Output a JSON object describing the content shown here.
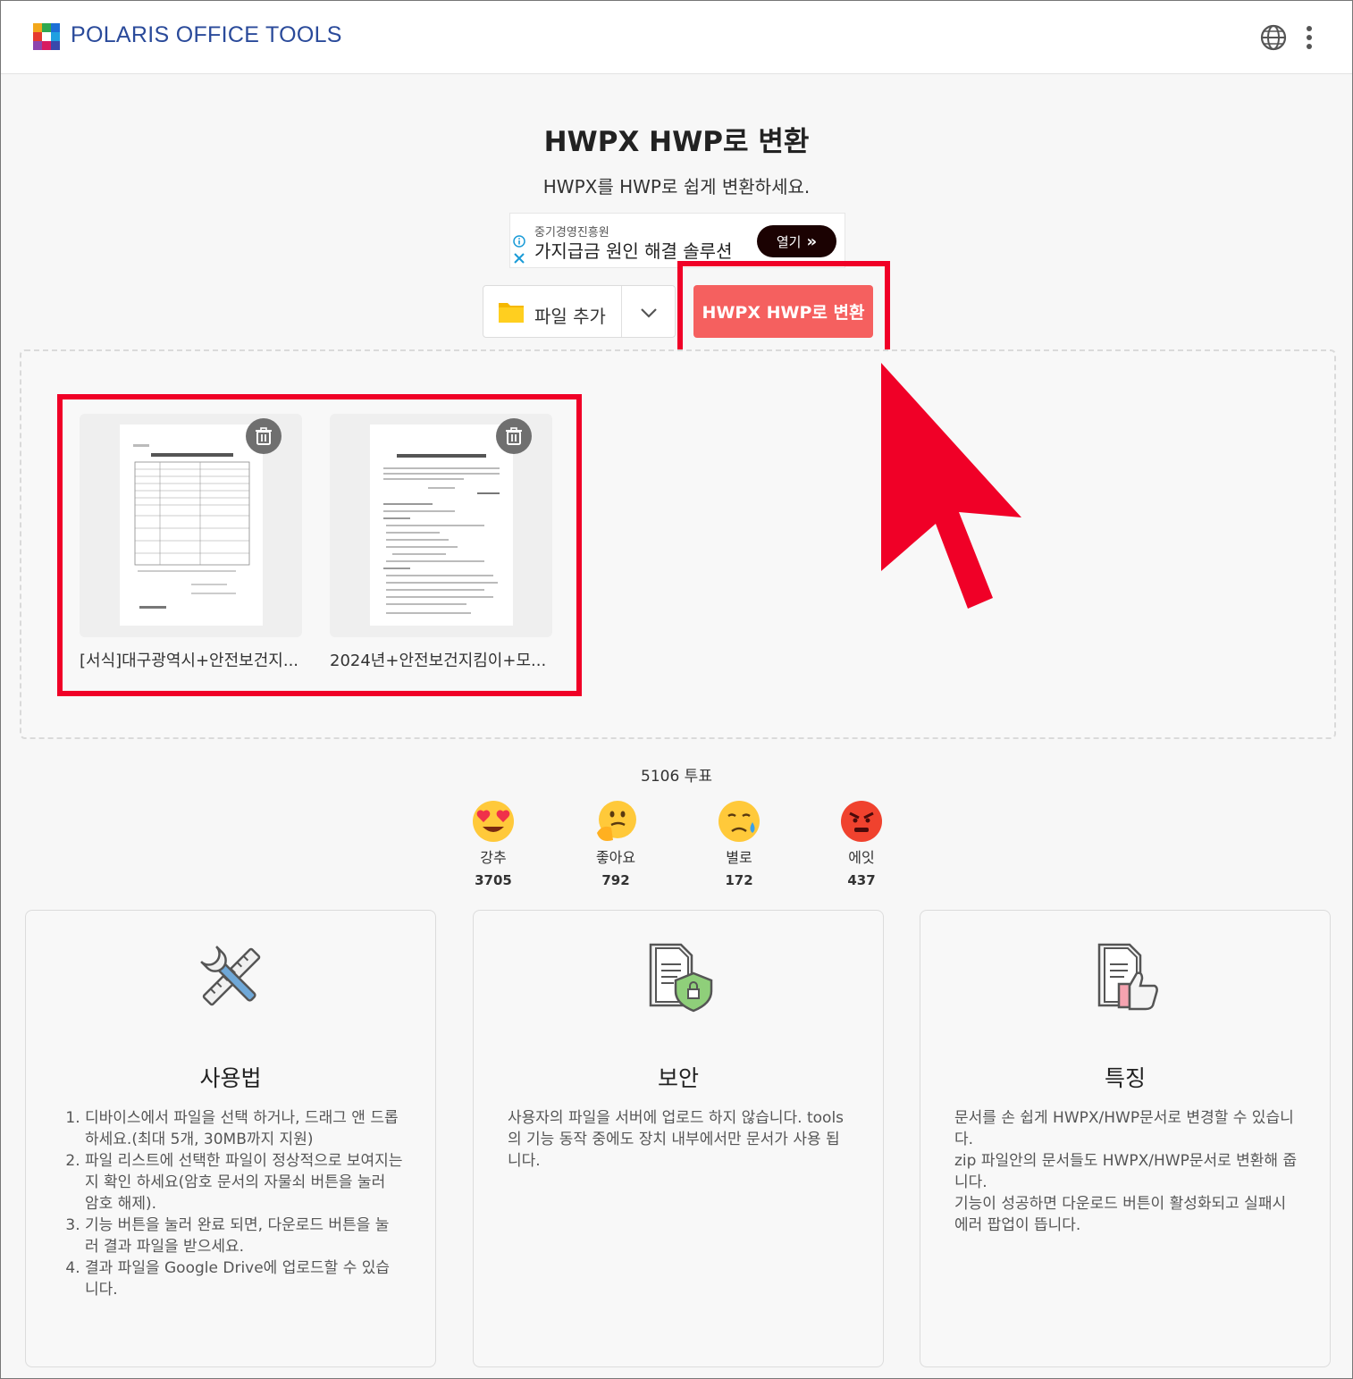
{
  "header": {
    "brand": "POLARIS OFFICE TOOLS",
    "icons": [
      "polaris-logo-icon",
      "globe-icon",
      "more-vertical-icon"
    ]
  },
  "page": {
    "title": "HWPX HWP로 변환",
    "subtitle": "HWPX를 HWP로 쉽게 변환하세요."
  },
  "ad": {
    "sponsor": "중기경영진흥원",
    "headline": "가지급금 원인 해결 솔루션",
    "open_label": "열기"
  },
  "toolbar": {
    "add_file_label": "파일 추가",
    "convert_label": "HWPX HWP로 변환"
  },
  "files": [
    {
      "name": "[서식]대구광역시+안전보건지..."
    },
    {
      "name": "2024년+안전보건지킴이+모..."
    }
  ],
  "votes": {
    "total": "5106 투표",
    "reactions": [
      {
        "label": "강추",
        "count": "3705",
        "icon": "heart-eyes-emoji-icon"
      },
      {
        "label": "좋아요",
        "count": "792",
        "icon": "thinking-emoji-icon"
      },
      {
        "label": "별로",
        "count": "172",
        "icon": "sad-tear-emoji-icon"
      },
      {
        "label": "에잇",
        "count": "437",
        "icon": "angry-emoji-icon"
      }
    ]
  },
  "features": [
    {
      "title": "사용법",
      "icon": "tools-icon",
      "steps": [
        "디바이스에서 파일을 선택 하거나, 드래그 앤 드롭 하세요.(최대 5개, 30MB까지 지원)",
        "파일 리스트에 선택한 파일이 정상적으로 보여지는지 확인 하세요(암호 문서의 자물쇠 버튼을 눌러 암호 해제).",
        "기능 버튼을 눌러 완료 되면, 다운로드 버튼을 눌러 결과 파일을 받으세요.",
        "결과 파일을 Google Drive에 업로드할 수 있습니다."
      ]
    },
    {
      "title": "보안",
      "icon": "secure-document-icon",
      "body": "사용자의 파일을 서버에 업로드 하지 않습니다. tools의 기능 동작 중에도 장치 내부에서만 문서가 사용 됩니다."
    },
    {
      "title": "특징",
      "icon": "document-thumbs-up-icon",
      "lines": [
        "문서를 손 쉽게 HWPX/HWP문서로 변경할 수 있습니다.",
        "zip 파일안의 문서들도 HWPX/HWP문서로 변환해 줍니다.",
        "기능이 성공하면 다운로드 버튼이 활성화되고 실패시 에러 팝업이 뜹니다."
      ]
    }
  ],
  "colors": {
    "accent": "#f5605f",
    "highlight": "#f00027",
    "brand": "#2a4a9a"
  }
}
